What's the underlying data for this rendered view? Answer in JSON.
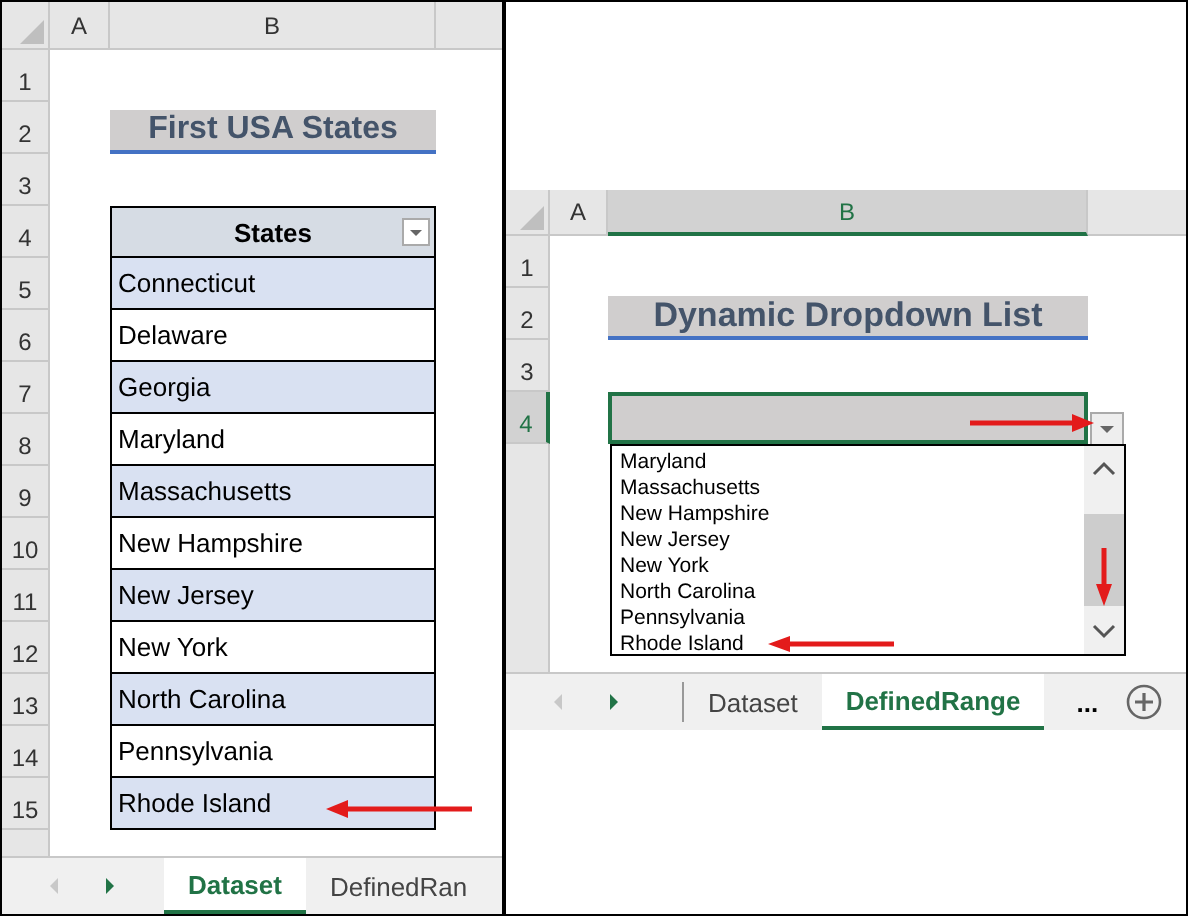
{
  "left_sheet": {
    "columns": [
      {
        "label": "A",
        "selected": false
      },
      {
        "label": "B",
        "selected": false
      }
    ],
    "rows": [
      {
        "label": "1",
        "selected": false
      },
      {
        "label": "2",
        "selected": false
      },
      {
        "label": "3",
        "selected": false
      },
      {
        "label": "4",
        "selected": false
      },
      {
        "label": "5",
        "selected": false
      },
      {
        "label": "6",
        "selected": false
      },
      {
        "label": "7",
        "selected": false
      },
      {
        "label": "8",
        "selected": false
      },
      {
        "label": "9",
        "selected": false
      },
      {
        "label": "10",
        "selected": false
      },
      {
        "label": "11",
        "selected": false
      },
      {
        "label": "12",
        "selected": false
      },
      {
        "label": "13",
        "selected": false
      },
      {
        "label": "14",
        "selected": false
      },
      {
        "label": "15",
        "selected": false
      }
    ],
    "title": "First USA States",
    "table": {
      "header": "States",
      "rows": [
        "Connecticut",
        "Delaware",
        "Georgia",
        "Maryland",
        "Massachusetts",
        "New Hampshire",
        "New Jersey",
        "New York",
        "North Carolina",
        "Pennsylvania",
        "Rhode Island"
      ]
    },
    "tabs": [
      {
        "label": "Dataset",
        "selected": true
      },
      {
        "label": "DefinedRan",
        "selected": false
      }
    ]
  },
  "right_sheet": {
    "columns": [
      {
        "label": "A",
        "selected": false
      },
      {
        "label": "B",
        "selected": true
      }
    ],
    "rows": [
      {
        "label": "1",
        "selected": false
      },
      {
        "label": "2",
        "selected": false
      },
      {
        "label": "3",
        "selected": false
      },
      {
        "label": "4",
        "selected": true
      }
    ],
    "title": "Dynamic Dropdown List",
    "dropdown": {
      "options": [
        "Maryland",
        "Massachusetts",
        "New Hampshire",
        "New Jersey",
        "New York",
        "North Carolina",
        "Pennsylvania",
        "Rhode Island"
      ]
    },
    "tabs": [
      {
        "label": "Dataset",
        "selected": false
      },
      {
        "label": "DefinedRange",
        "selected": true
      }
    ],
    "more": "..."
  }
}
